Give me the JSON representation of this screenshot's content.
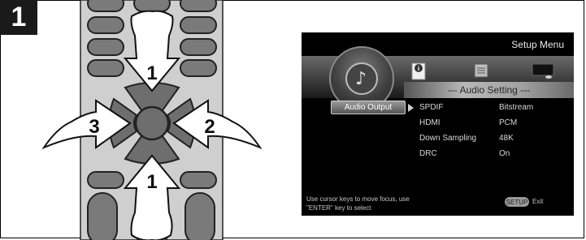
{
  "step": {
    "number": "1"
  },
  "remote": {
    "arrows": [
      "1",
      "2",
      "3",
      "1"
    ]
  },
  "tv": {
    "title": "Setup Menu",
    "section_title": "--- Audio Setting ---",
    "tabs": [
      "audio-disc-icon",
      "info-icon",
      "video-settings-icon",
      "display-icon"
    ],
    "selected_button": "Audio Output",
    "rows": [
      {
        "label": "SPDIF",
        "value": "Bitstream"
      },
      {
        "label": "HDMI",
        "value": "PCM"
      },
      {
        "label": "Down Sampling",
        "value": "48K"
      },
      {
        "label": "DRC",
        "value": "On"
      }
    ],
    "help_line1": "Use cursor keys to move focus, use",
    "help_line2": "\"ENTER\" key to select",
    "setup_key": "SETUP",
    "exit_label": "Exit"
  }
}
